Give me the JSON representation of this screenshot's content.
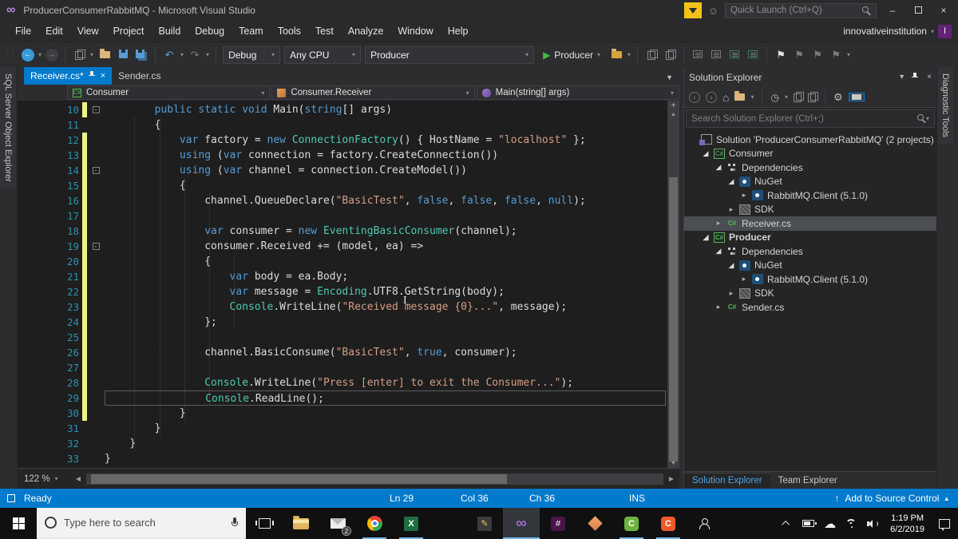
{
  "colors": {
    "accent": "#007acc",
    "keyword": "#569cd6",
    "type": "#4ec9b0",
    "string": "#d69d85",
    "line_number": "#2b91af",
    "change_bar": "#eff284",
    "active_tab": "#007acc",
    "editor_bg": "#1e1e1e"
  },
  "title_bar": {
    "title": "ProducerConsumerRabbitMQ - Microsoft Visual Studio",
    "quick_launch_placeholder": "Quick Launch (Ctrl+Q)",
    "account_name": "innovativeinstitution",
    "avatar_letter": "I"
  },
  "menu_bar": {
    "items": [
      "File",
      "Edit",
      "View",
      "Project",
      "Build",
      "Debug",
      "Team",
      "Tools",
      "Test",
      "Analyze",
      "Window",
      "Help"
    ]
  },
  "toolbar": {
    "configuration": "Debug",
    "platform": "Any CPU",
    "startup_project": "Producer",
    "run_label": "Producer"
  },
  "side_strips": {
    "left": "SQL Server Object Explorer",
    "right": "Diagnostic Tools"
  },
  "editor": {
    "tabs": [
      {
        "label": "Receiver.cs*",
        "active": true
      },
      {
        "label": "Sender.cs",
        "active": false
      }
    ],
    "nav_dropdowns": [
      {
        "label": "Consumer",
        "icon": "csharp-project"
      },
      {
        "label": "Consumer.Receiver",
        "icon": "class"
      },
      {
        "label": "Main(string[] args)",
        "icon": "method"
      }
    ],
    "zoom_level": "122 %",
    "lines": [
      {
        "num": 10,
        "indent": 8,
        "fold": true,
        "changed": true,
        "tokens": [
          [
            "k",
            "public"
          ],
          [
            "p",
            " "
          ],
          [
            "k",
            "static"
          ],
          [
            "p",
            " "
          ],
          [
            "k",
            "void"
          ],
          [
            "p",
            " Main("
          ],
          [
            "k",
            "string"
          ],
          [
            "p",
            "[] args)"
          ]
        ]
      },
      {
        "num": 11,
        "indent": 8,
        "tokens": [
          [
            "p",
            "{"
          ]
        ]
      },
      {
        "num": 12,
        "indent": 12,
        "changed": true,
        "tokens": [
          [
            "k",
            "var"
          ],
          [
            "p",
            " factory = "
          ],
          [
            "k",
            "new"
          ],
          [
            "p",
            " "
          ],
          [
            "t",
            "ConnectionFactory"
          ],
          [
            "p",
            "() { HostName = "
          ],
          [
            "s",
            "\"localhost\""
          ],
          [
            "p",
            " };"
          ]
        ]
      },
      {
        "num": 13,
        "indent": 12,
        "changed": true,
        "tokens": [
          [
            "k",
            "using"
          ],
          [
            "p",
            " ("
          ],
          [
            "k",
            "var"
          ],
          [
            "p",
            " connection = factory.CreateConnection())"
          ]
        ]
      },
      {
        "num": 14,
        "indent": 12,
        "fold": true,
        "changed": true,
        "tokens": [
          [
            "k",
            "using"
          ],
          [
            "p",
            " ("
          ],
          [
            "k",
            "var"
          ],
          [
            "p",
            " channel = connection.CreateModel())"
          ]
        ]
      },
      {
        "num": 15,
        "indent": 12,
        "changed": true,
        "tokens": [
          [
            "p",
            "{"
          ]
        ]
      },
      {
        "num": 16,
        "indent": 16,
        "changed": true,
        "tokens": [
          [
            "p",
            "channel.QueueDeclare("
          ],
          [
            "s",
            "\"BasicTest\""
          ],
          [
            "p",
            ", "
          ],
          [
            "k",
            "false"
          ],
          [
            "p",
            ", "
          ],
          [
            "k",
            "false"
          ],
          [
            "p",
            ", "
          ],
          [
            "k",
            "false"
          ],
          [
            "p",
            ", "
          ],
          [
            "k",
            "null"
          ],
          [
            "p",
            ");"
          ]
        ]
      },
      {
        "num": 17,
        "indent": 0,
        "changed": true,
        "tokens": []
      },
      {
        "num": 18,
        "indent": 16,
        "changed": true,
        "tokens": [
          [
            "k",
            "var"
          ],
          [
            "p",
            " consumer = "
          ],
          [
            "k",
            "new"
          ],
          [
            "p",
            " "
          ],
          [
            "t",
            "EventingBasicConsumer"
          ],
          [
            "p",
            "(channel);"
          ]
        ]
      },
      {
        "num": 19,
        "indent": 16,
        "fold": true,
        "changed": true,
        "tokens": [
          [
            "p",
            "consumer.Received += (model, ea) =>"
          ]
        ]
      },
      {
        "num": 20,
        "indent": 16,
        "changed": true,
        "tokens": [
          [
            "p",
            "{"
          ]
        ]
      },
      {
        "num": 21,
        "indent": 20,
        "changed": true,
        "tokens": [
          [
            "k",
            "var"
          ],
          [
            "p",
            " body = ea.Body;"
          ]
        ]
      },
      {
        "num": 22,
        "indent": 20,
        "changed": true,
        "tokens": [
          [
            "k",
            "var"
          ],
          [
            "p",
            " message = "
          ],
          [
            "t",
            "Encoding"
          ],
          [
            "p",
            ".UTF8.GetString(body);"
          ]
        ]
      },
      {
        "num": 23,
        "indent": 20,
        "changed": true,
        "tokens": [
          [
            "t",
            "Console"
          ],
          [
            "p",
            ".WriteLine("
          ],
          [
            "s",
            "\"Received message {0}...\""
          ],
          [
            "p",
            ", message);"
          ]
        ]
      },
      {
        "num": 24,
        "indent": 16,
        "changed": true,
        "tokens": [
          [
            "p",
            "};"
          ]
        ]
      },
      {
        "num": 25,
        "indent": 0,
        "changed": true,
        "tokens": []
      },
      {
        "num": 26,
        "indent": 16,
        "changed": true,
        "tokens": [
          [
            "p",
            "channel.BasicConsume("
          ],
          [
            "s",
            "\"BasicTest\""
          ],
          [
            "p",
            ", "
          ],
          [
            "k",
            "true"
          ],
          [
            "p",
            ", consumer);"
          ]
        ]
      },
      {
        "num": 27,
        "indent": 0,
        "changed": true,
        "tokens": []
      },
      {
        "num": 28,
        "indent": 16,
        "changed": true,
        "tokens": [
          [
            "t",
            "Console"
          ],
          [
            "p",
            ".WriteLine("
          ],
          [
            "s",
            "\"Press [enter] to exit the Consumer...\""
          ],
          [
            "p",
            ");"
          ]
        ]
      },
      {
        "num": 29,
        "indent": 16,
        "changed": true,
        "current": true,
        "tokens": [
          [
            "t",
            "Console"
          ],
          [
            "p",
            ".ReadLine();"
          ]
        ]
      },
      {
        "num": 30,
        "indent": 12,
        "changed": true,
        "tokens": [
          [
            "p",
            "}"
          ]
        ]
      },
      {
        "num": 31,
        "indent": 8,
        "tokens": [
          [
            "p",
            "}"
          ]
        ]
      },
      {
        "num": 32,
        "indent": 4,
        "tokens": [
          [
            "p",
            "}"
          ]
        ]
      },
      {
        "num": 33,
        "indent": 0,
        "tokens": [
          [
            "p",
            "}"
          ]
        ]
      }
    ]
  },
  "solution_explorer": {
    "title": "Solution Explorer",
    "search_placeholder": "Search Solution Explorer (Ctrl+;)",
    "tree": [
      {
        "depth": 0,
        "icon": "solution",
        "label": "Solution 'ProducerConsumerRabbitMQ' (2 projects)",
        "expander": "none"
      },
      {
        "depth": 1,
        "icon": "csproj",
        "label": "Consumer",
        "expander": "expanded"
      },
      {
        "depth": 2,
        "icon": "dep",
        "label": "Dependencies",
        "expander": "expanded"
      },
      {
        "depth": 3,
        "icon": "nuget",
        "label": "NuGet",
        "expander": "expanded"
      },
      {
        "depth": 4,
        "icon": "nuget",
        "label": "RabbitMQ.Client (5.1.0)",
        "expander": "collapsed"
      },
      {
        "depth": 3,
        "icon": "sdk",
        "label": "SDK",
        "expander": "collapsed"
      },
      {
        "depth": 2,
        "icon": "csfile",
        "label": "Receiver.cs",
        "expander": "collapsed",
        "selected": true
      },
      {
        "depth": 1,
        "icon": "csproj",
        "label": "Producer",
        "expander": "expanded",
        "bold": true
      },
      {
        "depth": 2,
        "icon": "dep",
        "label": "Dependencies",
        "expander": "expanded"
      },
      {
        "depth": 3,
        "icon": "nuget",
        "label": "NuGet",
        "expander": "expanded"
      },
      {
        "depth": 4,
        "icon": "nuget",
        "label": "RabbitMQ.Client (5.1.0)",
        "expander": "collapsed"
      },
      {
        "depth": 3,
        "icon": "sdk",
        "label": "SDK",
        "expander": "collapsed"
      },
      {
        "depth": 2,
        "icon": "csfile",
        "label": "Sender.cs",
        "expander": "collapsed"
      }
    ],
    "bottom_tabs": [
      {
        "label": "Solution Explorer",
        "active": true
      },
      {
        "label": "Team Explorer",
        "active": false
      }
    ]
  },
  "status_bar": {
    "state": "Ready",
    "line": "Ln 29",
    "column": "Col 36",
    "character": "Ch 36",
    "mode": "INS",
    "source_control_label": "Add to Source Control"
  },
  "taskbar": {
    "search_placeholder": "Type here to search",
    "mail_badge": "2",
    "time": "1:19 PM",
    "date": "6/2/2019"
  }
}
